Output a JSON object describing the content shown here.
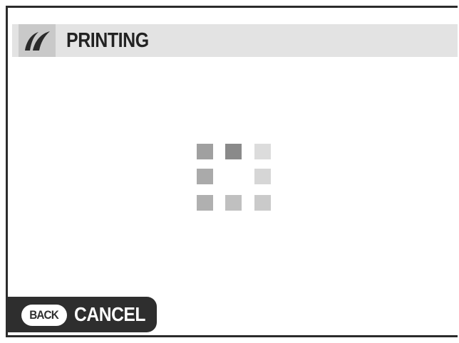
{
  "header": {
    "icon": "print-swoosh-icon",
    "title": "PRINTING"
  },
  "progress": {
    "icon": "loading-spinner-icon",
    "squares": [
      {
        "id": "top-left",
        "color": "#a0a0a0"
      },
      {
        "id": "top-middle",
        "color": "#8a8a8a"
      },
      {
        "id": "top-right",
        "color": "#dcdcdc"
      },
      {
        "id": "middle-left",
        "color": "#aaaaaa"
      },
      {
        "id": "middle-right",
        "color": "#d6d6d6"
      },
      {
        "id": "bottom-left",
        "color": "#b0b0b0"
      },
      {
        "id": "bottom-middle",
        "color": "#c0c0c0"
      },
      {
        "id": "bottom-right",
        "color": "#cacaca"
      }
    ]
  },
  "footer": {
    "back_key": "BACK",
    "cancel_label": "CANCEL"
  },
  "colors": {
    "title_bar": "#e3e3e3",
    "icon_box": "#c9c9c9",
    "pill": "#2e2e2e",
    "frame": "#2b2b2b"
  }
}
